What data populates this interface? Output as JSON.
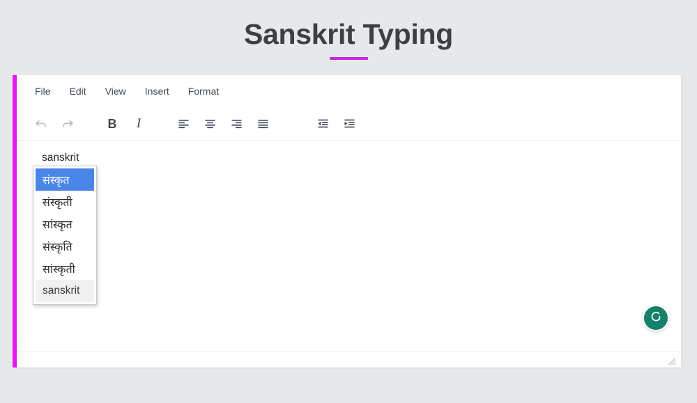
{
  "page": {
    "title": "Sanskrit Typing",
    "background_color": "#e7e8ea",
    "accent_color": "#c52ae0",
    "title_color": "#3c4043"
  },
  "editor": {
    "accent_bar_color": "#e519f0",
    "menubar": {
      "items": [
        {
          "label": "File",
          "name": "menu-file"
        },
        {
          "label": "Edit",
          "name": "menu-edit"
        },
        {
          "label": "View",
          "name": "menu-view"
        },
        {
          "label": "Insert",
          "name": "menu-insert"
        },
        {
          "label": "Format",
          "name": "menu-format"
        }
      ]
    },
    "toolbar": {
      "buttons": [
        {
          "icon": "undo-icon",
          "label": "Undo"
        },
        {
          "icon": "redo-icon",
          "label": "Redo"
        },
        {
          "icon": "bold-icon",
          "label": "B"
        },
        {
          "icon": "italic-icon",
          "label": "I"
        },
        {
          "icon": "align-left-icon",
          "label": "Align left"
        },
        {
          "icon": "align-center-icon",
          "label": "Align center"
        },
        {
          "icon": "align-right-icon",
          "label": "Align right"
        },
        {
          "icon": "align-justify-icon",
          "label": "Justify"
        },
        {
          "icon": "outdent-icon",
          "label": "Decrease indent"
        },
        {
          "icon": "indent-icon",
          "label": "Increase indent"
        }
      ]
    },
    "body": {
      "typed_text": "sanskrit"
    },
    "suggestions": {
      "selected_index": 0,
      "highlight_color": "#4a86e8",
      "items": [
        {
          "label": "संस्कृत"
        },
        {
          "label": "संस्कृती"
        },
        {
          "label": "सांस्कृत"
        },
        {
          "label": "संस्कृति"
        },
        {
          "label": "सांस्कृती"
        },
        {
          "label": "sanskrit"
        }
      ]
    },
    "assistant_badge": {
      "name": "grammarly-icon",
      "color": "#15806b"
    },
    "statusbar": {
      "resize_handle": "resize-grip-icon"
    }
  }
}
